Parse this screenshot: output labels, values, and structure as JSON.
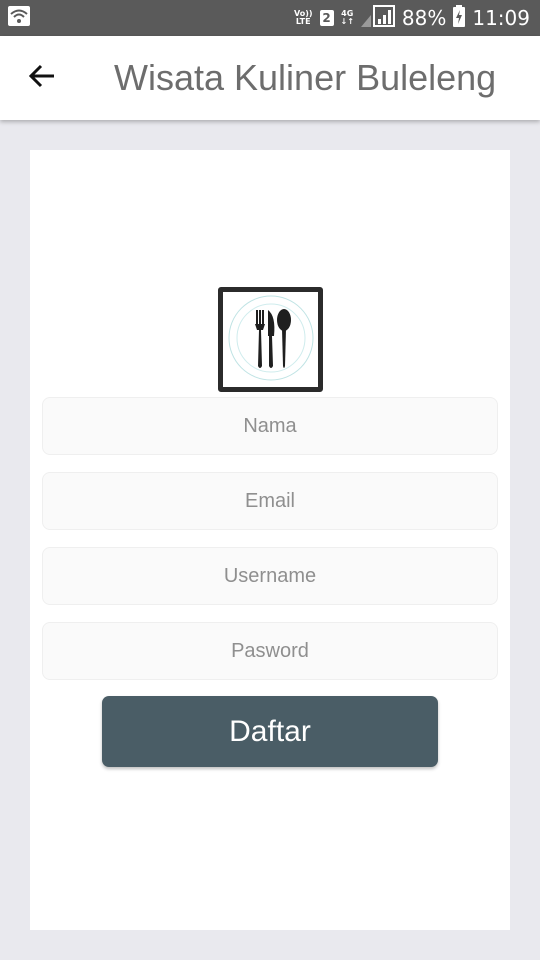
{
  "status_bar": {
    "volte_top": "Vo))",
    "volte_bottom": "LTE",
    "sim_slot": "2",
    "network_type": "4G",
    "battery_percent": "88%",
    "time": "11:09",
    "icons": [
      "wifi-icon",
      "signal-icon",
      "battery-charging-icon"
    ]
  },
  "app_bar": {
    "title": "Wisata Kuliner Buleleng",
    "back_icon": "arrow-left-icon"
  },
  "form": {
    "logo_icon": "cutlery-icon",
    "fields": {
      "name_placeholder": "Nama",
      "email_placeholder": "Email",
      "username_placeholder": "Username",
      "password_placeholder": "Pasword"
    },
    "submit_label": "Daftar"
  },
  "colors": {
    "status_bar": "#5a5a5a",
    "background": "#e9e9ee",
    "button": "#4a5d66",
    "title_text": "#6d6d6d",
    "placeholder_text": "#8f8f8f"
  }
}
